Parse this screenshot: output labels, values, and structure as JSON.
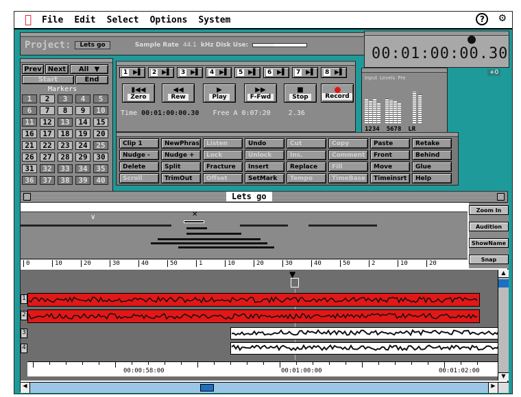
{
  "menubar": {
    "items": [
      "File",
      "Edit",
      "Select",
      "Options",
      "System"
    ]
  },
  "project": {
    "label": "Project:",
    "name": "Lets go",
    "sample_rate_label": "Sample Rate",
    "sample_rate_value": "44.1",
    "disk_label": "kHz Disk Use:"
  },
  "clock": {
    "time": "00:01:00:00.30",
    "sub": "+0"
  },
  "markers": {
    "prev": "Prev",
    "next": "Next",
    "all": "All",
    "start": "Start",
    "end": "End",
    "title": "Markers",
    "grid": [
      "1",
      "2",
      "3",
      "4",
      "5",
      "6",
      "7",
      "8",
      "9",
      "10",
      "11",
      "12",
      "13",
      "14",
      "15",
      "16",
      "17",
      "18",
      "19",
      "20",
      "21",
      "22",
      "23",
      "24",
      "25",
      "26",
      "27",
      "28",
      "29",
      "30",
      "31",
      "32",
      "33",
      "34",
      "35",
      "36",
      "37",
      "38",
      "39",
      "40"
    ],
    "active": [
      2,
      7,
      8,
      9,
      12,
      14,
      15,
      16,
      17,
      18,
      19,
      20,
      21,
      22,
      23,
      24,
      26,
      27,
      28,
      29,
      30,
      31
    ]
  },
  "transport": {
    "tracks": [
      "1",
      "2",
      "3",
      "4",
      "5",
      "6",
      "7",
      "8"
    ],
    "zero": "Zero",
    "rew": "Rew",
    "play": "Play",
    "ffwd": "F-Fwd",
    "stop": "Stop",
    "record": "Record",
    "time_label": "Time",
    "time": "00:01:00:00.30",
    "free_label": "Free A",
    "free_value": "0:07:20",
    "extra": "2.36"
  },
  "levels": {
    "headers": [
      "Input",
      "Levels",
      "Pre"
    ],
    "labels": [
      "1234",
      "5678",
      "LR"
    ]
  },
  "edit_buttons": [
    [
      "Clip 1",
      "NewPhras",
      "Listen",
      "Undo",
      "Cut",
      "Copy",
      "Paste",
      "Retake"
    ],
    [
      "Nudge -",
      "Nudge +",
      "Lock",
      "Unlock",
      "Ins.",
      "Comment",
      "Front",
      "Behind"
    ],
    [
      "Delete",
      "Split",
      "Fracture",
      "Insert",
      "Replace",
      "Fill",
      "Move",
      "Glue"
    ],
    [
      "Scroll",
      "TrimOut",
      "Offset",
      "SetMark",
      "Tempo",
      "TimeBase",
      "Timeinsrt",
      "Help"
    ]
  ],
  "edit_disabled": [
    "Listen",
    "Lock",
    "Unlock",
    "Ins.",
    "Comment",
    "Cut",
    "Copy",
    "Fill",
    "Scroll",
    "Offset",
    "TimeBase",
    "Tempo"
  ],
  "track_window": {
    "title": "Lets go",
    "side_buttons": [
      "Zoom In",
      "Audition",
      "ShowName",
      "Snap"
    ],
    "ruler_upper": [
      "0",
      "10",
      "20",
      "30",
      "40",
      "50",
      "1",
      "10",
      "20",
      "30",
      "40",
      "50",
      "2",
      "10",
      "20"
    ],
    "ruler_lower": [
      "00:00:58:00",
      "00:01:00:00",
      "00:01:02:00"
    ],
    "track_nums": [
      "1",
      "2",
      "3",
      "4"
    ]
  },
  "colors": {
    "desktop": "#1e9a9a",
    "red_track": "#e01818",
    "panel": "#8a8a8a"
  }
}
